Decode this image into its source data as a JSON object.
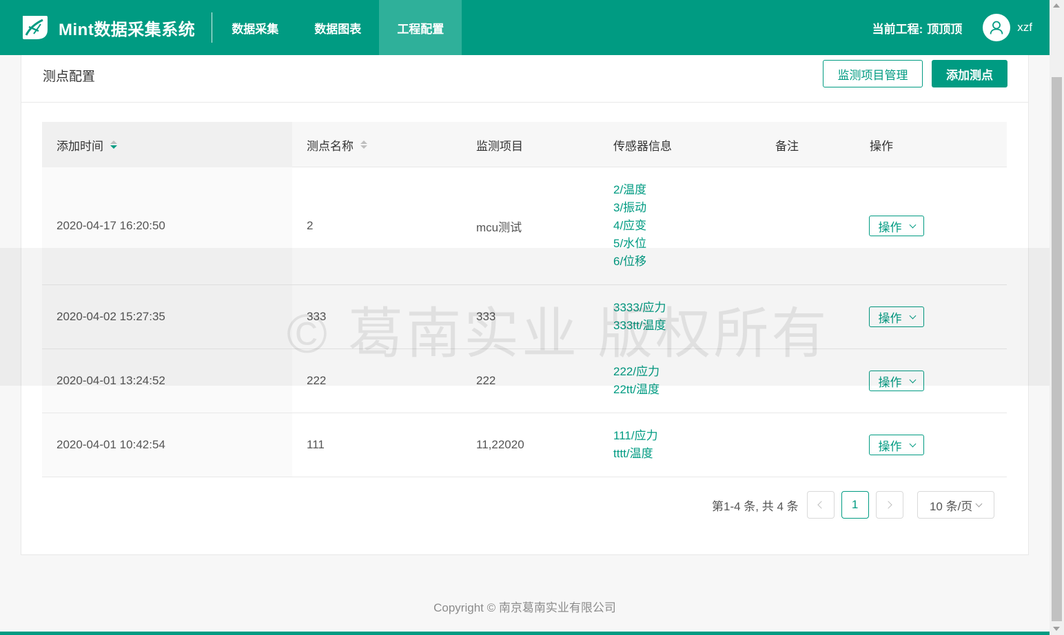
{
  "header": {
    "app_title": "Mint数据采集系统",
    "nav": [
      {
        "label": "数据采集"
      },
      {
        "label": "数据图表"
      },
      {
        "label": "工程配置"
      }
    ],
    "project_label": "当前工程:",
    "project_name": "顶顶顶",
    "username": "xzf",
    "colors": {
      "primary": "#009b82",
      "active_tab": "#2fb09a"
    }
  },
  "card": {
    "title": "测点配置",
    "manage_button": "监测项目管理",
    "add_button": "添加测点"
  },
  "table": {
    "columns": [
      "添加时间",
      "测点名称",
      "监测项目",
      "传感器信息",
      "备注",
      "操作"
    ],
    "rows": [
      {
        "time": "2020-04-17 16:20:50",
        "name": "2",
        "project": "mcu测试",
        "sensors": [
          "2/温度",
          "3/振动",
          "4/应变",
          "5/水位",
          "6/位移"
        ],
        "note": "",
        "op": "操作"
      },
      {
        "time": "2020-04-02 15:27:35",
        "name": "333",
        "project": "333",
        "sensors": [
          "3333/应力",
          "333tt/温度"
        ],
        "note": "",
        "op": "操作"
      },
      {
        "time": "2020-04-01 13:24:52",
        "name": "222",
        "project": "222",
        "sensors": [
          "222/应力",
          "22tt/温度"
        ],
        "note": "",
        "op": "操作"
      },
      {
        "time": "2020-04-01 10:42:54",
        "name": "111",
        "project": "11,22020",
        "sensors": [
          "111/应力",
          "tttt/温度"
        ],
        "note": "",
        "op": "操作"
      }
    ]
  },
  "pagination": {
    "total_text": "第1-4 条, 共 4 条",
    "current_page": "1",
    "page_size": "10 条/页"
  },
  "footer": {
    "copyright": "Copyright © 南京葛南实业有限公司"
  },
  "watermark": {
    "text": "© 葛南实业 版权所有"
  }
}
